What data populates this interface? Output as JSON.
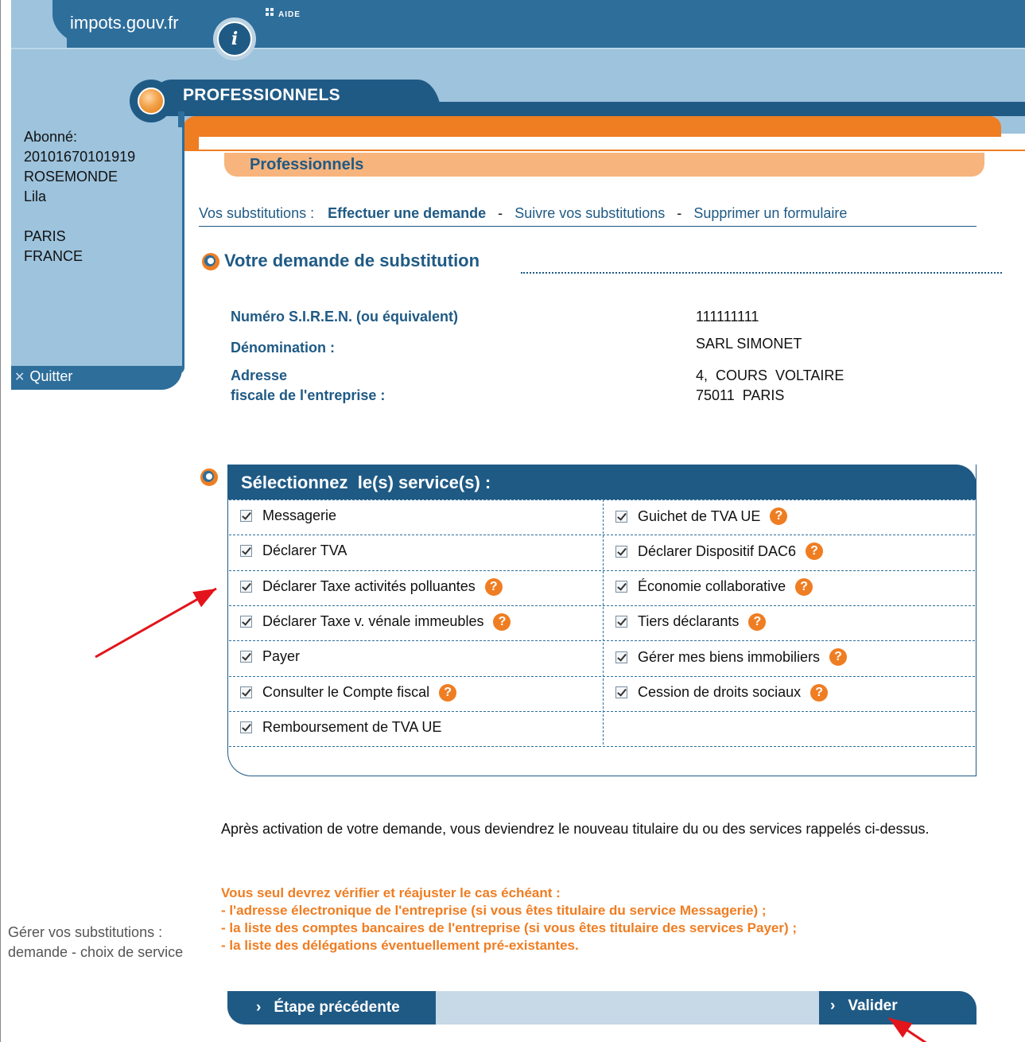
{
  "header": {
    "brand": "impots.gouv.fr",
    "badge": "i",
    "help_link": "AIDE",
    "section_tab": "PROFESSIONNELS",
    "sub_title": "Professionnels"
  },
  "sidebar": {
    "user_lines": [
      "Abonné:",
      "20101670101919",
      "ROSEMONDE",
      "Lila",
      "",
      "PARIS",
      "FRANCE"
    ],
    "quit_label": "Quitter"
  },
  "nav": {
    "label": "Vos substitutions :",
    "items": [
      "Effectuer une demande",
      "Suivre vos substitutions",
      "Supprimer un formulaire"
    ],
    "separator": "-"
  },
  "request": {
    "title": "Votre demande de substitution",
    "fields": [
      {
        "label": "Numéro S.I.R.E.N. (ou équivalent)",
        "value": "111111111"
      },
      {
        "label": "Dénomination :",
        "value": "SARL SIMONET"
      },
      {
        "label_lines": [
          "Adresse",
          "fiscale de l'entreprise :"
        ],
        "value_lines": [
          "4,  COURS  VOLTAIRE",
          "75011  PARIS"
        ]
      }
    ]
  },
  "services": {
    "title": "Sélectionnez  le(s) service(s) :",
    "left": [
      {
        "label": "Messagerie",
        "checked": true,
        "help": false
      },
      {
        "label": "Déclarer TVA",
        "checked": true,
        "help": false
      },
      {
        "label": "Déclarer Taxe activités polluantes",
        "checked": true,
        "help": true
      },
      {
        "label": "Déclarer Taxe v. vénale immeubles",
        "checked": true,
        "help": true
      },
      {
        "label": "Payer",
        "checked": true,
        "help": false
      },
      {
        "label": "Consulter le Compte fiscal",
        "checked": true,
        "help": true
      },
      {
        "label": "Remboursement de TVA UE",
        "checked": true,
        "help": false
      }
    ],
    "right": [
      {
        "label": "Guichet de TVA UE",
        "checked": true,
        "help": true
      },
      {
        "label": "Déclarer Dispositif DAC6",
        "checked": true,
        "help": true
      },
      {
        "label": "Économie collaborative",
        "checked": true,
        "help": true
      },
      {
        "label": "Tiers déclarants",
        "checked": true,
        "help": true
      },
      {
        "label": "Gérer mes biens immobiliers",
        "checked": true,
        "help": true
      },
      {
        "label": "Cession de droits sociaux",
        "checked": true,
        "help": true
      }
    ],
    "help_glyph": "?"
  },
  "info_text": "Après activation de votre demande, vous deviendrez le nouveau titulaire du ou des services rappelés ci-dessus.",
  "warning_lines": [
    "Vous seul devrez vérifier et réajuster le cas échéant :",
    "- l'adresse électronique de l'entreprise (si vous êtes titulaire du service Messagerie) ;",
    "- la liste des comptes bancaires de l'entreprise (si vous êtes titulaire des services Payer) ;",
    "- la liste des délégations éventuellement pré-existantes."
  ],
  "side_note": "Gérer vos substitutions : demande - choix de service",
  "actions": {
    "previous": "Étape précédente",
    "submit": "Valider",
    "chevron": "›"
  },
  "colors": {
    "primary": "#1f5a85",
    "mid_blue": "#2e6e9b",
    "light_blue": "#9dc3dd",
    "orange": "#ef7d22",
    "peach": "#f7b47c",
    "annotation_red": "#e3141b"
  }
}
